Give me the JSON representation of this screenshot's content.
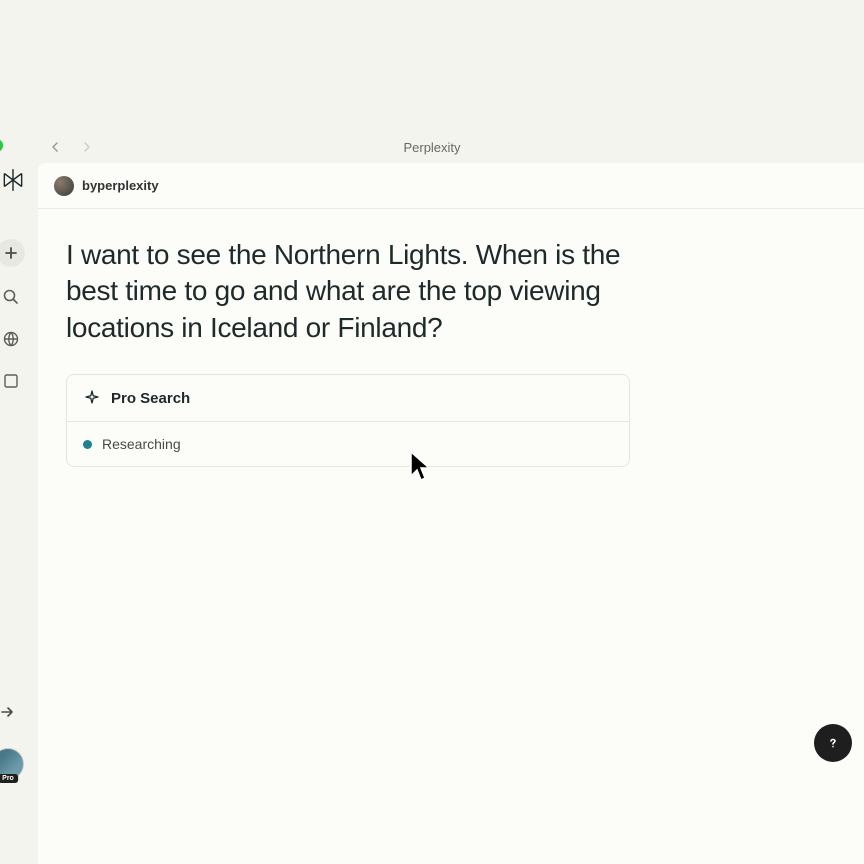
{
  "window": {
    "title": "Perplexity"
  },
  "author": {
    "name": "byperplexity"
  },
  "query": "I want to see the Northern Lights. When is the best time to go and what are the top viewing locations in Iceland or Finland?",
  "pro_search": {
    "label": "Pro Search",
    "status": "Researching"
  },
  "sidebar": {
    "pro_badge": "Pro"
  },
  "colors": {
    "accent": "#20808d",
    "bg": "#f4f4ef",
    "content_bg": "#fcfcf9"
  }
}
